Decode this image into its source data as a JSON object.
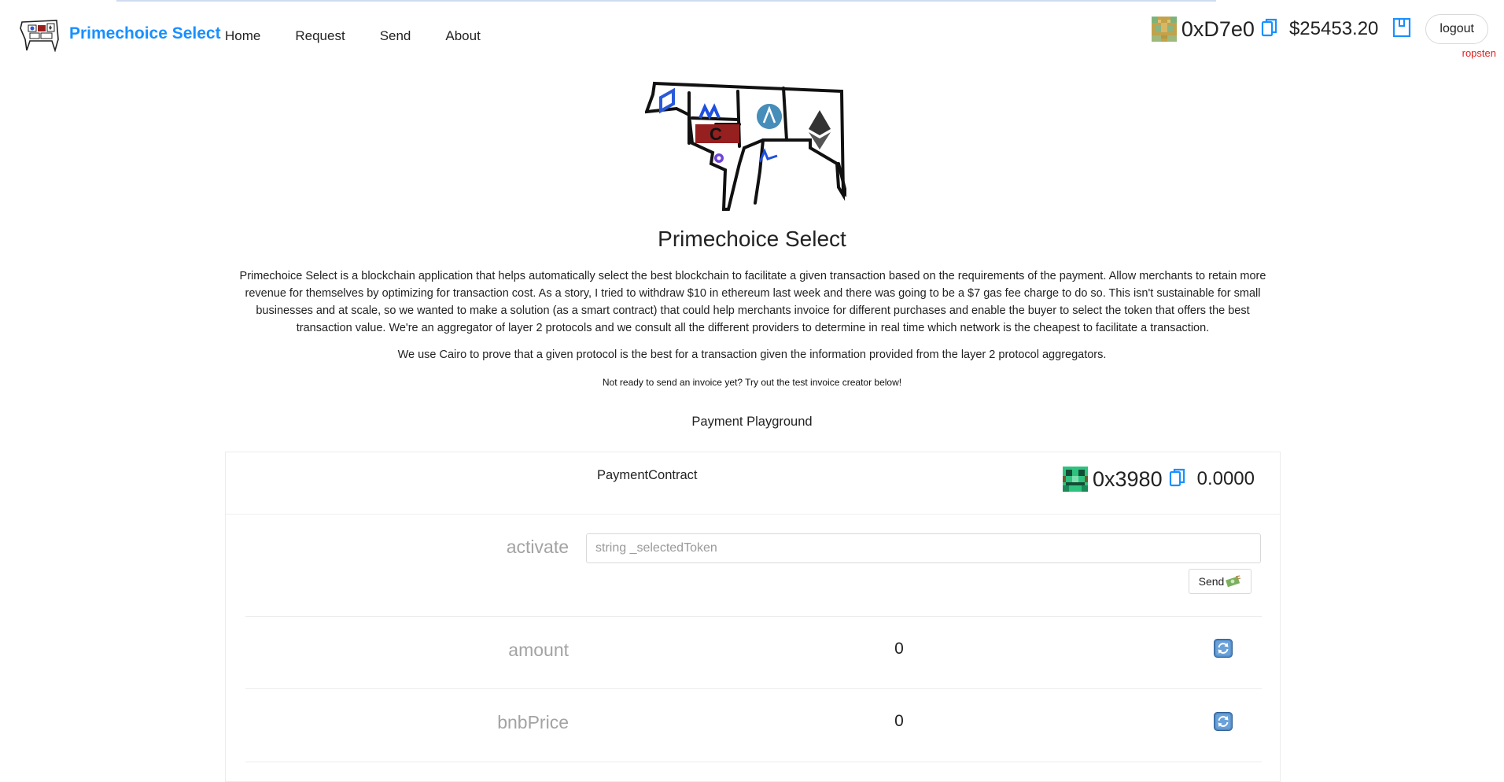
{
  "header": {
    "brand_title": "Primechoice Select",
    "nav": [
      "Home",
      "Request",
      "Send",
      "About"
    ],
    "account": {
      "address": "0xD7e0",
      "balance": "$25453.20",
      "logout_label": "logout",
      "network": "ropsten"
    }
  },
  "hero": {
    "title": "Primechoice Select",
    "description": "Primechoice Select is a blockchain application that helps automatically select the best blockchain to facilitate a given transaction based on the requirements of the payment. Allow merchants to retain more revenue for themselves by optimizing for transaction cost. As a story, I tried to withdraw $10 in ethereum last week and there was going to be a $7 gas fee charge to do so. This isn't sustainable for small businesses and at scale, so we wanted to make a solution (as a smart contract) that could help merchants invoice for different purchases and enable the buyer to select the token that offers the best transaction value. We're an aggregator of layer 2 protocols and we consult all the different providers to determine in real time which network is the cheapest to facilitate a transaction.",
    "description2": "We use Cairo to prove that a given protocol is the best for a transaction given the information provided from the layer 2 protocol aggregators.",
    "note": "Not ready to send an invoice yet? Try out the test invoice creator below!",
    "logo_letter": "C"
  },
  "playground": {
    "title": "Payment Playground",
    "contract": {
      "name": "PaymentContract",
      "address": "0x3980",
      "balance": "0.0000"
    },
    "functions": {
      "activate": {
        "label": "activate",
        "placeholder": "string _selectedToken",
        "value": "",
        "send_label": "Send"
      },
      "amount": {
        "label": "amount",
        "value": "0"
      },
      "bnbPrice": {
        "label": "bnbPrice",
        "value": "0"
      }
    }
  },
  "colors": {
    "brand": "#1890ff",
    "network": "#e0201f",
    "label_gray": "#a3a3a3"
  },
  "icons": [
    "cow-logo-icon",
    "blockie-avatar-icon",
    "copy-icon",
    "wallet-icon",
    "money-icon",
    "refresh-icon"
  ]
}
